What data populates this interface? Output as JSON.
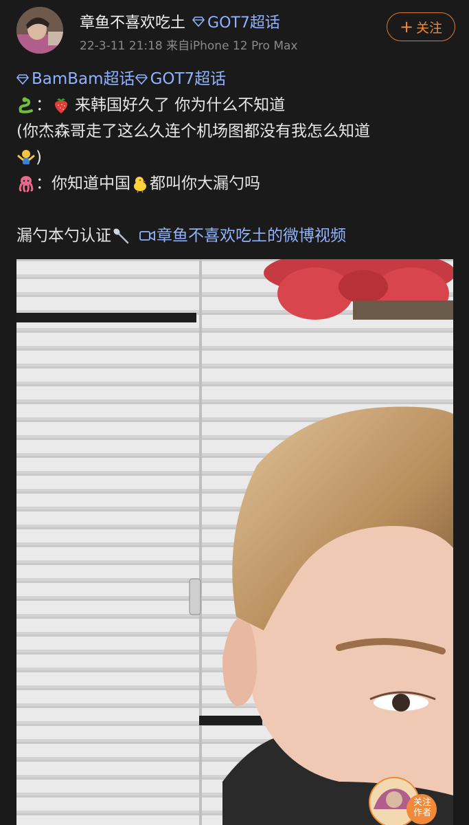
{
  "post": {
    "username": "章鱼不喜欢吃土",
    "topic_tag": "GOT7超话",
    "meta": "22-3-11 21:18  来自iPhone 12 Pro Max",
    "follow_label": "关注",
    "topics": [
      "BamBam超话",
      "GOT7超话"
    ],
    "line1_sep": "：",
    "line1_text": "来韩国好久了 你为什么不知道",
    "line2": "(你杰森哥走了这么久连个机场图都没有我怎么知道",
    "line3_end": ")",
    "line4_a": "：你知道中国",
    "line4_b": "都叫你大漏勺吗",
    "line5": "漏勺本勺认证",
    "video_link": "章鱼不喜欢吃土的微博视频"
  },
  "video": {
    "overlay_follow_l1": "关注",
    "overlay_follow_l2": "作者"
  },
  "colors": {
    "link": "#8fb3ff",
    "accent": "#f08a3a",
    "bg": "#1a1a1a"
  }
}
